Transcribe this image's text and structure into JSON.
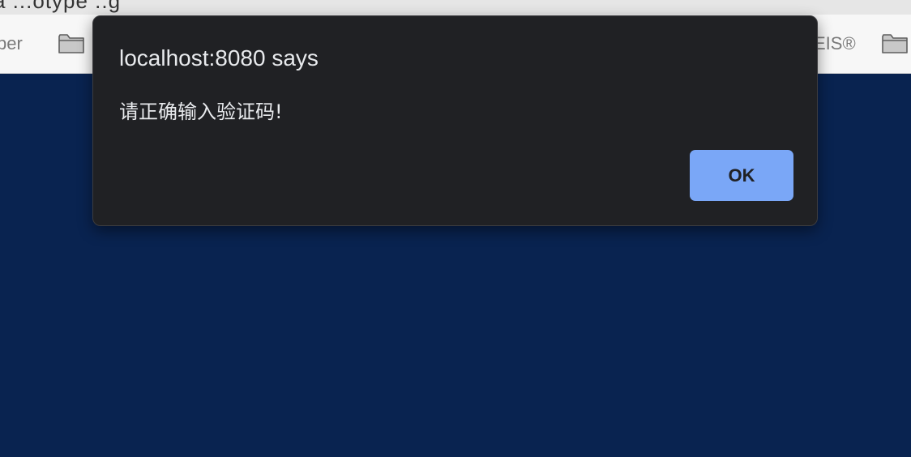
{
  "window": {
    "title_partial": "a  ...otype  ..g"
  },
  "bookmarks_bar": {
    "items": [
      {
        "label": "per",
        "icon": "folder-icon"
      },
      {
        "label": "",
        "icon": "folder-icon"
      },
      {
        "label": "EIS®",
        "icon": "folder-icon"
      }
    ]
  },
  "alert": {
    "title": "localhost:8080 says",
    "message": "请正确输入验证码!",
    "ok_label": "OK"
  },
  "colors": {
    "page_background": "#092350",
    "dialog_background": "#202124",
    "ok_button": "#7aa7f7",
    "bookmarks_bar": "#f7f7f7"
  }
}
